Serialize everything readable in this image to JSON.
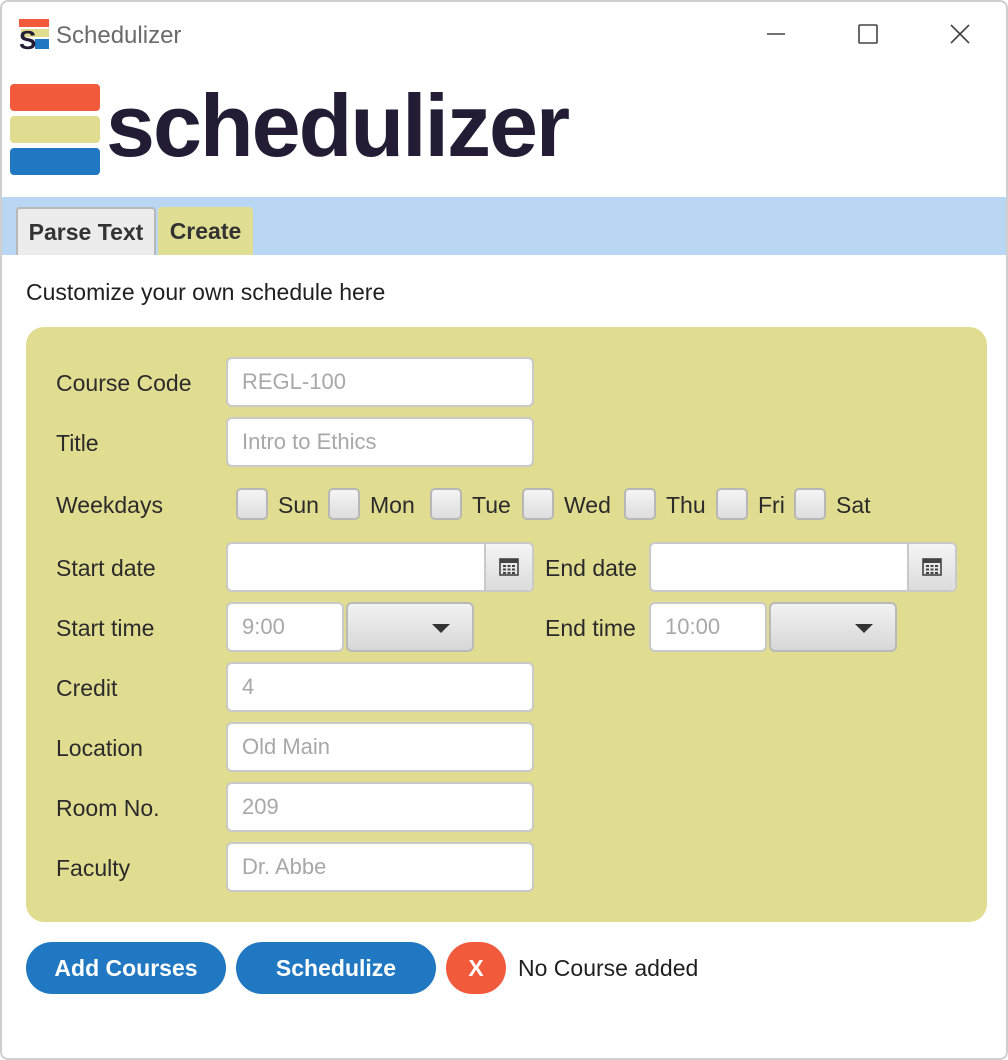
{
  "window": {
    "title": "Schedulizer",
    "icon": "schedulizer-app-icon",
    "controls": [
      "minimize-icon",
      "maximize-icon",
      "close-icon"
    ]
  },
  "logo": {
    "text": "schedulizer",
    "bar_colors": [
      "#f15a3a",
      "#e0dd90",
      "#1f78c1"
    ]
  },
  "tabs": [
    {
      "label": "Parse Text",
      "active": false
    },
    {
      "label": "Create",
      "active": true
    }
  ],
  "subtitle": "Customize your own schedule here",
  "form": {
    "course_code": {
      "label": "Course Code",
      "placeholder": "REGL-100",
      "value": ""
    },
    "title": {
      "label": "Title",
      "placeholder": "Intro to Ethics",
      "value": ""
    },
    "weekdays": {
      "label": "Weekdays",
      "days": [
        {
          "label": "Sun",
          "checked": false
        },
        {
          "label": "Mon",
          "checked": false
        },
        {
          "label": "Tue",
          "checked": false
        },
        {
          "label": "Wed",
          "checked": false
        },
        {
          "label": "Thu",
          "checked": false
        },
        {
          "label": "Fri",
          "checked": false
        },
        {
          "label": "Sat",
          "checked": false
        }
      ]
    },
    "start_date": {
      "label": "Start date",
      "value": ""
    },
    "end_date": {
      "label": "End date",
      "value": ""
    },
    "start_time": {
      "label": "Start time",
      "placeholder": "9:00",
      "value": "",
      "period": ""
    },
    "end_time": {
      "label": "End time",
      "placeholder": "10:00",
      "value": "",
      "period": ""
    },
    "credit": {
      "label": "Credit",
      "placeholder": "4",
      "value": ""
    },
    "location": {
      "label": "Location",
      "placeholder": "Old Main",
      "value": ""
    },
    "room": {
      "label": "Room No.",
      "placeholder": "209",
      "value": ""
    },
    "faculty": {
      "label": "Faculty",
      "placeholder": "Dr. Abbe",
      "value": ""
    }
  },
  "actions": {
    "add_label": "Add Courses",
    "schedulize_label": "Schedulize",
    "clear_label": "X",
    "status": "No Course added"
  },
  "colors": {
    "accent_blue": "#1f78c1",
    "accent_red": "#f15a3a",
    "panel_yellow": "#e0dd90",
    "tabstrip_blue": "#b9d6f2",
    "logo_text": "#231c34"
  }
}
